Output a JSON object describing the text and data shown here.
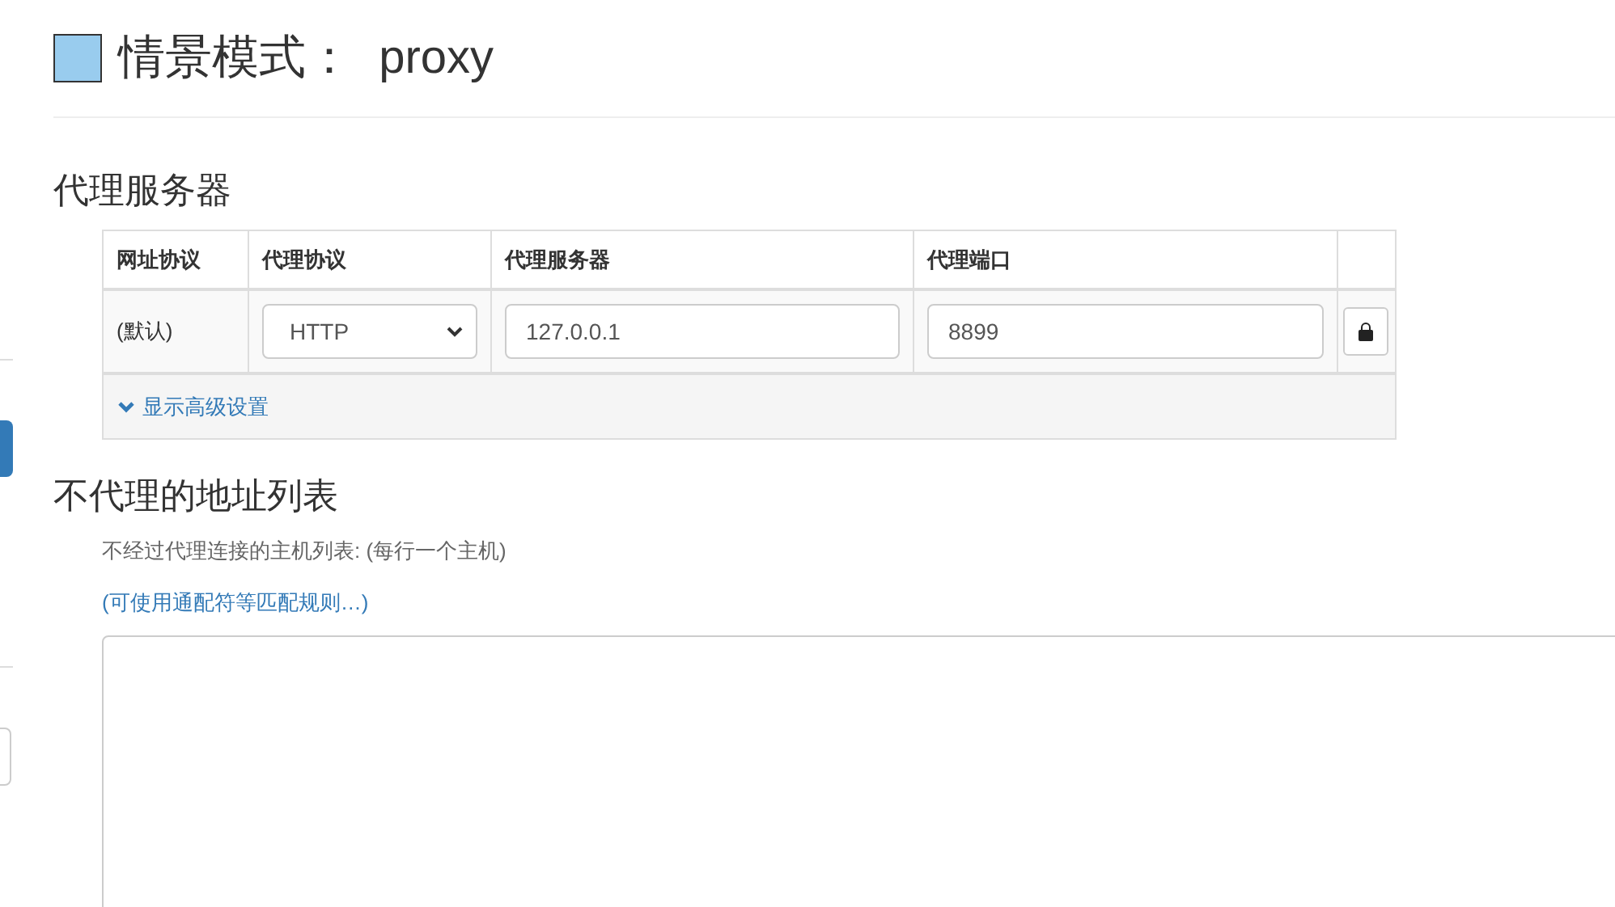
{
  "profile": {
    "color": "#99ccee",
    "label": "情景模式：",
    "name": "proxy"
  },
  "proxy_section": {
    "heading": "代理服务器",
    "table": {
      "columns": [
        "网址协议",
        "代理协议",
        "代理服务器",
        "代理端口"
      ],
      "rows": [
        {
          "scheme": "(默认)",
          "protocol": "HTTP",
          "server": "127.0.0.1",
          "port": "8899"
        }
      ],
      "advanced_toggle": "显示高级设置"
    }
  },
  "bypass_section": {
    "heading": "不代理的地址列表",
    "description": "不经过代理连接的主机列表: (每行一个主机)",
    "help_link": "(可使用通配符等匹配规则…)"
  }
}
